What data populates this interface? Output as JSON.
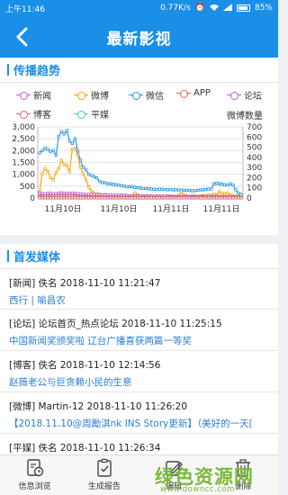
{
  "status_bar": {
    "time": "上午11:46",
    "speed": "0.77K/s",
    "battery": "85%"
  },
  "app_bar": {
    "title": "最新影视"
  },
  "trend": {
    "section_title": "传播趋势",
    "legend": [
      {
        "label": "新闻",
        "color": "#c25bd6"
      },
      {
        "label": "微博",
        "color": "#f2a100"
      },
      {
        "label": "微信",
        "color": "#1a8fe8"
      },
      {
        "label": "APP",
        "color": "#e8604a"
      },
      {
        "label": "论坛",
        "color": "#b35ce0"
      },
      {
        "label": "博客",
        "color": "#e8607a"
      },
      {
        "label": "平媒",
        "color": "#3fc9c9"
      }
    ],
    "right_axis_label": "微博数量"
  },
  "chart_data": {
    "type": "line",
    "left_axis": {
      "ticks": [
        "0",
        "500",
        "1,000",
        "1,500",
        "2,000",
        "2,500",
        "3,000"
      ],
      "ylim": [
        0,
        3000
      ]
    },
    "right_axis": {
      "title": "微博数量",
      "ticks": [
        "0",
        "100",
        "200",
        "300",
        "400",
        "500",
        "600",
        "700"
      ],
      "ylim": [
        0,
        700
      ]
    },
    "x_ticks": [
      "11月10日",
      "11月10日",
      "11月11日",
      "11月11日"
    ],
    "grid": true,
    "series": [
      {
        "name": "微信",
        "axis": "left",
        "color": "#1a8fe8",
        "values": [
          1900,
          2000,
          2100,
          2050,
          1950,
          2000,
          1800,
          2600,
          2800,
          2700,
          2850,
          2400,
          2300,
          2500,
          2000,
          1600,
          1300,
          1200,
          1000,
          950,
          900,
          850,
          700,
          650,
          650,
          600,
          600,
          580,
          560,
          550,
          520,
          500,
          480,
          470,
          480,
          450,
          430,
          420,
          400,
          400,
          390,
          380,
          370,
          360,
          380,
          370,
          360,
          350,
          360,
          340,
          350,
          340,
          330,
          330,
          320,
          320,
          300,
          310,
          330,
          340,
          350,
          360,
          380,
          380,
          600,
          620,
          600,
          580,
          560,
          550,
          600,
          550,
          350,
          200,
          150
        ]
      },
      {
        "name": "微博",
        "axis": "right",
        "color": "#f2a100",
        "values": [
          60,
          240,
          290,
          260,
          200,
          180,
          250,
          290,
          370,
          330,
          320,
          260,
          480,
          490,
          420,
          300,
          240,
          180,
          110,
          70,
          50,
          40,
          40,
          30,
          35,
          30,
          30,
          28,
          30,
          25,
          30,
          28,
          25,
          20,
          25,
          50,
          30,
          20,
          20,
          18,
          20,
          18,
          15,
          20,
          20,
          18,
          15,
          20,
          20,
          18,
          15,
          20,
          60,
          30,
          20,
          18,
          20,
          20,
          18,
          20,
          25,
          20,
          30,
          25,
          40,
          30,
          60,
          45,
          40,
          50,
          30,
          25,
          20,
          15,
          12
        ]
      },
      {
        "name": "论坛",
        "axis": "left",
        "color": "#b35ce0",
        "values": [
          100,
          110,
          120,
          130,
          120,
          110,
          130,
          150,
          160,
          150,
          140,
          130,
          150,
          140,
          120,
          110,
          100,
          100,
          90,
          95,
          90,
          85,
          80,
          80,
          85,
          80,
          80,
          75,
          80,
          70,
          75,
          80,
          75,
          70,
          70,
          75,
          70,
          70,
          65,
          70,
          70,
          65,
          65,
          60,
          70,
          65,
          60,
          60,
          65,
          60,
          60,
          55,
          60,
          60,
          55,
          60,
          60,
          55,
          60,
          60,
          65,
          60,
          60,
          65,
          70,
          70,
          65,
          60,
          60,
          55,
          60,
          50,
          40,
          30,
          20
        ]
      },
      {
        "name": "新闻",
        "axis": "left",
        "color": "#c25bd6",
        "values": [
          200,
          190,
          180,
          200,
          210,
          180,
          190,
          200,
          220,
          210,
          200,
          200,
          210,
          200,
          190,
          180,
          170,
          160,
          160,
          150,
          150,
          140,
          140,
          130,
          130,
          130,
          120,
          120,
          120,
          110,
          110,
          110,
          110,
          100,
          100,
          100,
          100,
          100,
          90,
          90,
          90,
          90,
          80,
          80,
          80,
          80,
          80,
          80,
          70,
          70,
          70,
          70,
          70,
          70,
          70,
          60,
          60,
          60,
          60,
          60,
          60,
          60,
          60,
          60,
          60,
          60,
          60,
          50,
          50,
          50,
          50,
          50,
          40,
          30,
          20
        ]
      },
      {
        "name": "APP",
        "axis": "left",
        "color": "#e8604a",
        "values": [
          60,
          70,
          80,
          70,
          60,
          70,
          80,
          90,
          80,
          70,
          80,
          90,
          80,
          70,
          60,
          60,
          60,
          50,
          50,
          50,
          50,
          50,
          50,
          45,
          45,
          45,
          45,
          40,
          40,
          40,
          40,
          40,
          40,
          40,
          40,
          35,
          35,
          35,
          35,
          35,
          35,
          30,
          30,
          30,
          30,
          30,
          30,
          30,
          30,
          30,
          30,
          25,
          25,
          25,
          25,
          25,
          25,
          25,
          25,
          25,
          25,
          20,
          20,
          20,
          20,
          20,
          20,
          20,
          20,
          20,
          20,
          15,
          15,
          10,
          10
        ]
      },
      {
        "name": "平媒",
        "axis": "left",
        "color": "#3fc9c9",
        "values": [
          10,
          10,
          10,
          10,
          10,
          10,
          10,
          10,
          10,
          10,
          10,
          10,
          10,
          10,
          10,
          10,
          10,
          10,
          10,
          10,
          10,
          10,
          10,
          10,
          10,
          10,
          10,
          10,
          10,
          10,
          10,
          10,
          10,
          10,
          10,
          10,
          10,
          10,
          10,
          10,
          10,
          10,
          10,
          10,
          10,
          10,
          10,
          10,
          10,
          10,
          10,
          10,
          10,
          10,
          10,
          10,
          10,
          10,
          10,
          10,
          10,
          10,
          10,
          10,
          10,
          10,
          10,
          10,
          10,
          10,
          10,
          10,
          10,
          10,
          10
        ]
      },
      {
        "name": "博客",
        "axis": "left",
        "color": "#e8607a",
        "values": [
          5,
          5,
          5,
          5,
          5,
          5,
          5,
          5,
          5,
          5,
          5,
          5,
          5,
          5,
          5,
          5,
          5,
          5,
          5,
          5,
          5,
          5,
          5,
          5,
          5,
          5,
          5,
          5,
          5,
          5,
          5,
          5,
          5,
          5,
          5,
          5,
          5,
          5,
          5,
          5,
          5,
          5,
          5,
          5,
          5,
          5,
          5,
          5,
          5,
          5,
          5,
          5,
          5,
          5,
          5,
          5,
          5,
          5,
          5,
          5,
          5,
          5,
          5,
          5,
          5,
          5,
          5,
          5,
          5,
          5,
          5,
          5,
          5,
          5,
          5
        ]
      }
    ]
  },
  "media": {
    "section_title": "首发媒体",
    "items": [
      {
        "line1": "[新闻] 佚名 2018-11-10 11:21:47",
        "line2": "西行 | 喻昌农"
      },
      {
        "line1": "[论坛] 论坛首页_热点论坛 2018-11-10 11:25:15",
        "line2": "中国新闻奖颁奖啦 辽台广播喜获两篇一等奖"
      },
      {
        "line1": "[博客] 佚名 2018-11-10 12:14:56",
        "line2": "赵薇老公与巨贪赖小民的生意"
      },
      {
        "line1": "[微博] Martin-12 2018-11-10 11:26:20",
        "line2": "【2018.11.10@周勵淇nk INS Story更新】（美好的一天["
      },
      {
        "line1": "[平媒] 佚名 2018-11-10 11:26:34",
        "line2": ""
      }
    ]
  },
  "bottom_nav": [
    {
      "label": "信息浏览"
    },
    {
      "label": "生成报告"
    },
    {
      "label": "编辑"
    },
    {
      "label": "删除"
    }
  ],
  "watermark": {
    "title": "绿色资源网",
    "url": "www.downcc.com"
  }
}
